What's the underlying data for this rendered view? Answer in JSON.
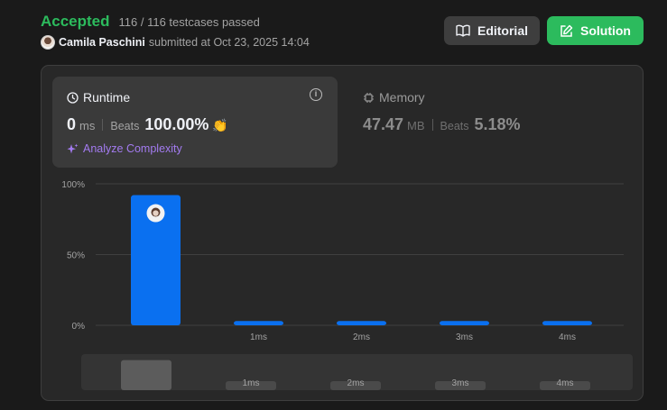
{
  "submission": {
    "status": "Accepted",
    "testcases": "116 / 116 testcases passed",
    "username": "Camila Paschini",
    "submitted_text": "submitted at Oct 23, 2025 14:04"
  },
  "buttons": {
    "editorial": "Editorial",
    "solution": "Solution"
  },
  "runtime": {
    "title": "Runtime",
    "value": "0",
    "unit": "ms",
    "beats_label": "Beats",
    "beats_value": "100.00%",
    "analyze": "Analyze Complexity"
  },
  "memory": {
    "title": "Memory",
    "value": "47.47",
    "unit": "MB",
    "beats_label": "Beats",
    "beats_value": "5.18%"
  },
  "colors": {
    "accepted": "#2cbb5d",
    "bar": "#0a70f0",
    "analyze": "#a37bf0"
  },
  "chart_data": {
    "type": "bar",
    "categories": [
      "0ms",
      "1ms",
      "2ms",
      "3ms",
      "4ms"
    ],
    "tick_labels": [
      "",
      "1ms",
      "2ms",
      "3ms",
      "4ms"
    ],
    "values": [
      92,
      3,
      3,
      3,
      3
    ],
    "y_ticks": [
      "100%",
      "50%",
      "0%"
    ],
    "ylim": [
      0,
      100
    ],
    "highlighted_category": "0ms",
    "grid": true
  }
}
